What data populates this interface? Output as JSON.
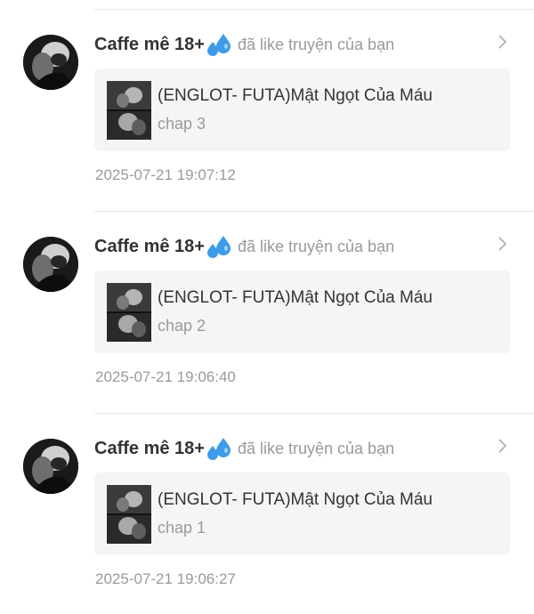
{
  "notifications": [
    {
      "user_name": "Caffe mê 18+",
      "action": "đã like truyện của bạn",
      "story_title": "(ENGLOT- FUTA)Mật Ngọt Của Máu",
      "chapter": "chap 3",
      "timestamp": "2025-07-21 19:07:12"
    },
    {
      "user_name": "Caffe mê 18+",
      "action": "đã like truyện của bạn",
      "story_title": "(ENGLOT- FUTA)Mật Ngọt Của Máu",
      "chapter": "chap 2",
      "timestamp": "2025-07-21 19:06:40"
    },
    {
      "user_name": "Caffe mê 18+",
      "action": "đã like truyện của bạn",
      "story_title": "(ENGLOT- FUTA)Mật Ngọt Của Máu",
      "chapter": "chap 1",
      "timestamp": "2025-07-21 19:06:27"
    }
  ],
  "icons": {
    "name_emoji": "sweat-droplets-icon",
    "row_arrow": "chevron-right-icon"
  },
  "colors": {
    "name_text": "#333333",
    "secondary_text": "#9a9a9a",
    "card_background": "#f5f5f5",
    "divider": "#e6e6e6",
    "droplet": "#3d9be9"
  }
}
